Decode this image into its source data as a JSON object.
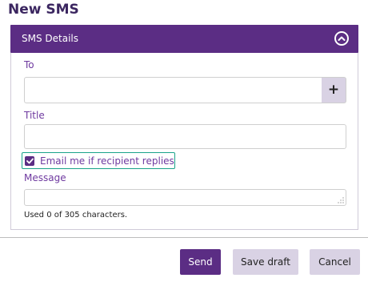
{
  "page": {
    "title": "New SMS"
  },
  "panel": {
    "title": "SMS Details",
    "collapse_icon": "chevron-up-circle-icon"
  },
  "form": {
    "to_label": "To",
    "to_value": "",
    "add_button_label": "+",
    "title_label": "Title",
    "title_value": "",
    "email_reply_label": "Email me if recipient replies",
    "email_reply_checked": true,
    "message_label": "Message",
    "message_value": "",
    "char_count_text": "Used 0 of 305 characters."
  },
  "actions": {
    "send_label": "Send",
    "save_draft_label": "Save draft",
    "cancel_label": "Cancel"
  },
  "colors": {
    "brand_purple": "#5b2d84",
    "label_purple": "#6f3aa0",
    "secondary_button": "#d9d2e4",
    "focus_teal": "#1aa38a"
  }
}
